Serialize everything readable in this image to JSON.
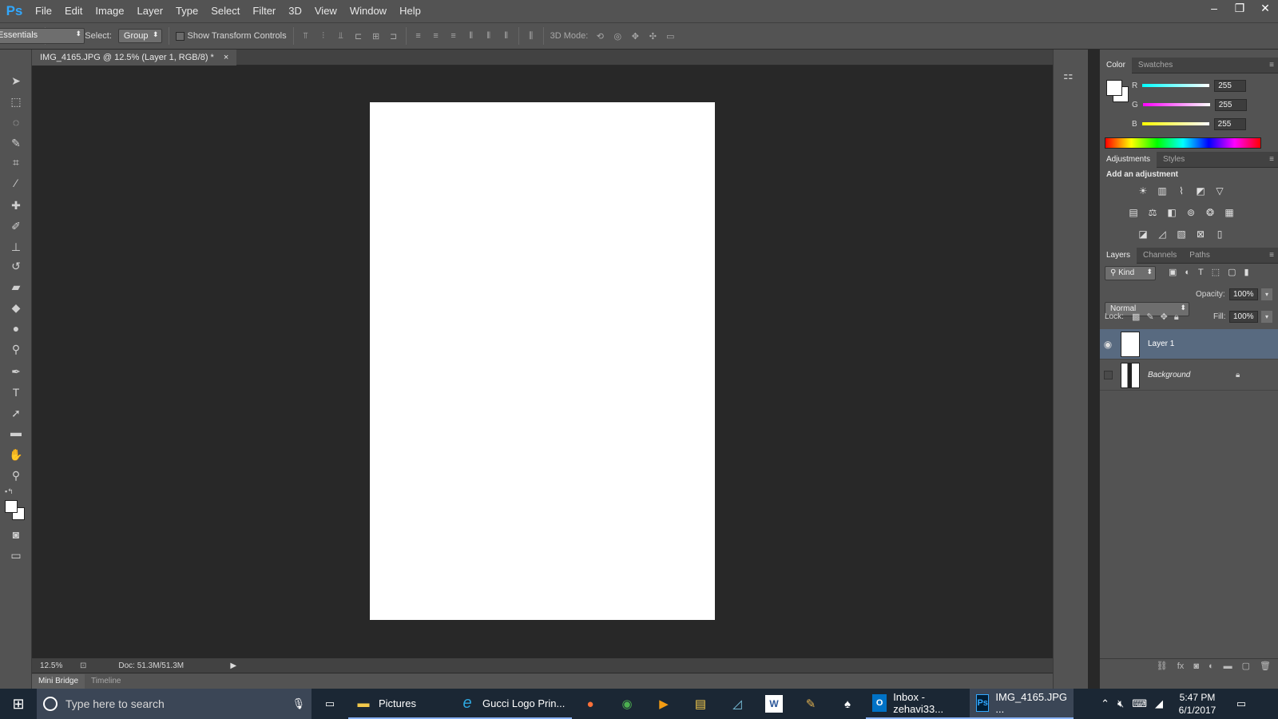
{
  "app": {
    "logo": "Ps"
  },
  "menu": [
    "File",
    "Edit",
    "Image",
    "Layer",
    "Type",
    "Select",
    "Filter",
    "3D",
    "View",
    "Window",
    "Help"
  ],
  "window_controls": {
    "minimize": "–",
    "restore": "❐",
    "close": "✕"
  },
  "options_bar": {
    "auto_select_label": "Auto-Select:",
    "auto_select_value": "Group",
    "show_transform_label": "Show Transform Controls",
    "mode_3d_label": "3D Mode:",
    "workspace": "Essentials"
  },
  "document": {
    "tab_title": "IMG_4165.JPG @ 12.5% (Layer 1, RGB/8) *",
    "close": "×"
  },
  "status": {
    "zoom": "12.5%",
    "doc_size": "Doc: 51.3M/51.3M"
  },
  "bottom_tabs": [
    "Mini Bridge",
    "Timeline"
  ],
  "color_panel": {
    "tabs": [
      "Color",
      "Swatches"
    ],
    "channels": [
      {
        "label": "R",
        "value": "255",
        "color": "#00c8c8"
      },
      {
        "label": "G",
        "value": "255",
        "color": "#e040e0"
      },
      {
        "label": "B",
        "value": "255",
        "color": "#e8e800"
      }
    ]
  },
  "adjustments_panel": {
    "tabs": [
      "Adjustments",
      "Styles"
    ],
    "heading": "Add an adjustment"
  },
  "layers_panel": {
    "tabs": [
      "Layers",
      "Channels",
      "Paths"
    ],
    "filter_kind": "Kind",
    "blend_mode": "Normal",
    "opacity_label": "Opacity:",
    "opacity_value": "100%",
    "lock_label": "Lock:",
    "fill_label": "Fill:",
    "fill_value": "100%",
    "layers": [
      {
        "name": "Layer 1",
        "visible": true,
        "selected": true
      },
      {
        "name": "Background",
        "visible": false,
        "locked": true
      }
    ]
  },
  "taskbar": {
    "search_placeholder": "Type here to search",
    "items": [
      {
        "label": "Pictures"
      },
      {
        "label": "Gucci Logo Prin..."
      },
      {
        "label": "Inbox - zehavi33..."
      },
      {
        "label": "IMG_4165.JPG ..."
      }
    ],
    "time": "5:47 PM",
    "date": "6/1/2017"
  }
}
